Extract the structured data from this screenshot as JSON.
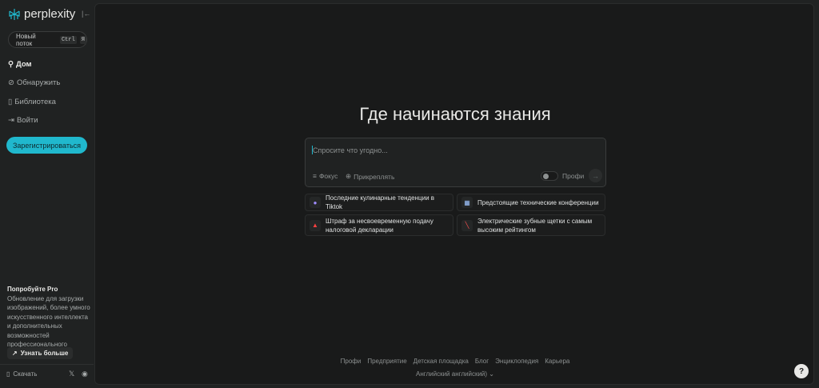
{
  "brand": {
    "name": "perplexity",
    "accent": "#20b8cd"
  },
  "sidebar": {
    "new_thread": "Новый поток",
    "kbd_ctrl": "Ctrl",
    "kbd_key": "Я",
    "items": [
      {
        "label": "Дом",
        "icon": "search-icon"
      },
      {
        "label": "Обнаружить",
        "icon": "compass-icon"
      },
      {
        "label": "Библиотека",
        "icon": "library-icon"
      },
      {
        "label": "Войти",
        "icon": "login-icon"
      }
    ],
    "signup": "Зарегистрироваться",
    "pro_title": "Попробуйте Pro",
    "pro_text": "Обновление для загрузки изображений, более умного искусственного интеллекта и дополнительных возможностей профессионального поиска.",
    "learn_more": "Узнать больше",
    "download": "Скачать"
  },
  "main": {
    "title": "Где начинаются знания",
    "placeholder": "Спросите что угодно...",
    "focus": "Фокус",
    "attach": "Прикреплять",
    "pro": "Профи",
    "suggestions": [
      {
        "label": "Последние кулинарные тенденции в Tiktok",
        "icon": "magnifier-emoji-icon"
      },
      {
        "label": "Предстоящие технические конференции",
        "icon": "calendar-icon"
      },
      {
        "label": "Штраф за несвоевременную подачу налоговой декларации",
        "icon": "siren-icon"
      },
      {
        "label": "Электрические зубные щетки с самым высоким рейтингом",
        "icon": "toothbrush-icon"
      }
    ]
  },
  "footer": {
    "links": [
      "Профи",
      "Предприятие",
      "Детская площадка",
      "Блог",
      "Энциклопедия",
      "Карьера"
    ],
    "language": "Английский английский)"
  }
}
